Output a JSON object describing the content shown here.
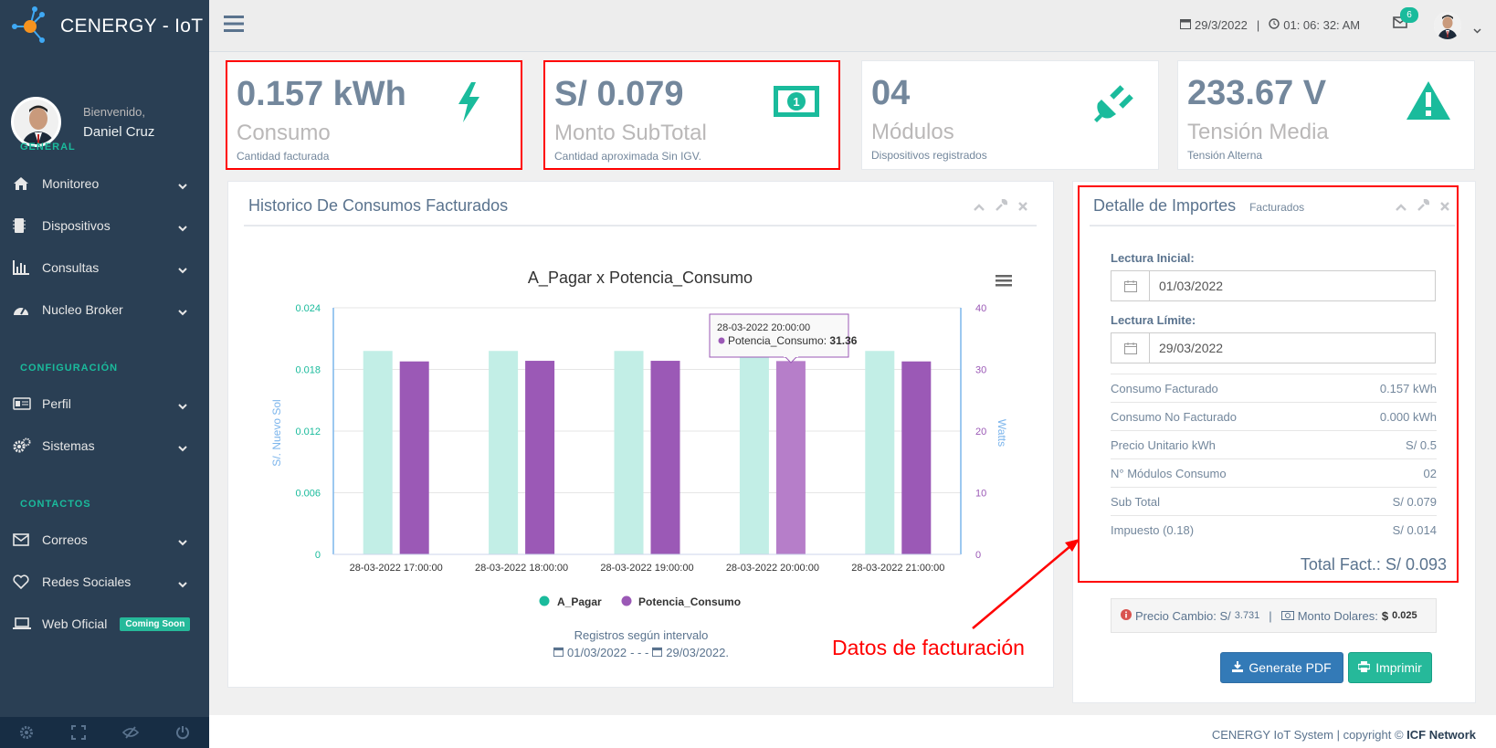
{
  "brand": {
    "name": "CENERGY - IoT"
  },
  "profile": {
    "welcome": "Bienvenido,",
    "name": "Daniel Cruz"
  },
  "sidebar": {
    "sections": [
      {
        "title": "GENERAL",
        "items": [
          {
            "label": "Monitoreo",
            "icon": "home-icon"
          },
          {
            "label": "Dispositivos",
            "icon": "chip-icon"
          },
          {
            "label": "Consultas",
            "icon": "bar-chart-icon"
          },
          {
            "label": "Nucleo Broker",
            "icon": "dashboard-icon"
          }
        ]
      },
      {
        "title": "CONFIGURACIÓN",
        "items": [
          {
            "label": "Perfil",
            "icon": "id-card-icon"
          },
          {
            "label": "Sistemas",
            "icon": "cogs-icon"
          }
        ]
      },
      {
        "title": "CONTACTOS",
        "items": [
          {
            "label": "Correos",
            "icon": "envelope-icon"
          },
          {
            "label": "Redes Sociales",
            "icon": "heart-icon"
          },
          {
            "label": "Web Oficial",
            "icon": "laptop-icon",
            "badge": "Coming Soon"
          }
        ]
      }
    ]
  },
  "topbar": {
    "date": "29/3/2022",
    "separator": "|",
    "time": "01: 06: 32: AM",
    "mail_count": "6"
  },
  "tiles": [
    {
      "value": "0.157 kWh",
      "label": "Consumo",
      "sub": "Cantidad facturada",
      "icon": "bolt-icon"
    },
    {
      "value": "S/ 0.079",
      "label": "Monto SubTotal",
      "sub": "Cantidad aproximada Sin IGV.",
      "icon": "money-icon"
    },
    {
      "value": "04",
      "label": "Módulos",
      "sub": "Dispositivos registrados",
      "icon": "plug-icon"
    },
    {
      "value": "233.67 V",
      "label": "Tensión Media",
      "sub": "Tensión Alterna",
      "icon": "warning-icon"
    }
  ],
  "history_panel": {
    "title": "Historico De Consumos Facturados",
    "footer_line1": "Registros según intervalo",
    "footer_date_from": "01/03/2022",
    "footer_sep": "- - -",
    "footer_date_to": "29/03/2022."
  },
  "chart_data": {
    "type": "bar",
    "title": "A_Pagar x Potencia_Consumo",
    "categories": [
      "28-03-2022 17:00:00",
      "28-03-2022 18:00:00",
      "28-03-2022 19:00:00",
      "28-03-2022 20:00:00",
      "28-03-2022 21:00:00"
    ],
    "series": [
      {
        "name": "A_Pagar",
        "axis": "left",
        "color": "#c2eee6",
        "legend_color": "#1abb9c",
        "values": [
          0.0198,
          0.0198,
          0.0198,
          0.0198,
          0.0198
        ]
      },
      {
        "name": "Potencia_Consumo",
        "axis": "right",
        "color": "#9b59b6",
        "legend_color": "#9b59b6",
        "values": [
          31.3,
          31.4,
          31.4,
          31.36,
          31.3
        ]
      }
    ],
    "y_left": {
      "label": "S/. Nuevo Sol",
      "ticks": [
        "0",
        "0.006",
        "0.012",
        "0.018",
        "0.024"
      ],
      "min": 0,
      "max": 0.024,
      "color": "#1abb9c"
    },
    "y_right": {
      "label": "Watts",
      "ticks": [
        "0",
        "10",
        "20",
        "30",
        "40"
      ],
      "min": 0,
      "max": 40,
      "color": "#9b59b6"
    },
    "tooltip": {
      "header": "28-03-2022 20:00:00",
      "series": "Potencia_Consumo",
      "value": "31.36"
    },
    "highlight_index": 3
  },
  "detail_panel": {
    "title": "Detalle de Importes",
    "subtitle": "Facturados",
    "lectura_inicial_label": "Lectura Inicial:",
    "lectura_inicial": "01/03/2022",
    "lectura_limite_label": "Lectura Límite:",
    "lectura_limite": "29/03/2022",
    "rows": [
      {
        "label": "Consumo Facturado",
        "value": "0.157 kWh"
      },
      {
        "label": "Consumo No Facturado",
        "value": "0.000 kWh"
      },
      {
        "label": "Precio Unitario kWh",
        "value": "S/ 0.5"
      },
      {
        "label": "N° Módulos Consumo",
        "value": "02"
      },
      {
        "label": "Sub Total",
        "value": "S/ 0.079"
      },
      {
        "label": "Impuesto (0.18)",
        "value": "S/ 0.014"
      }
    ],
    "total": "Total Fact.: S/ 0.093",
    "exchange_label": "Precio Cambio: S/",
    "exchange_value": "3.731",
    "exchange_sep": "|",
    "dollars_label": "Monto Dolares:",
    "dollars_sign": "$",
    "dollars_value": "0.025",
    "btn_pdf": "Generate PDF",
    "btn_print": "Imprimir"
  },
  "annotation": "Datos de facturación",
  "footer": {
    "text": "CENERGY IoT System | copyright ©",
    "brand": "ICF Network"
  }
}
